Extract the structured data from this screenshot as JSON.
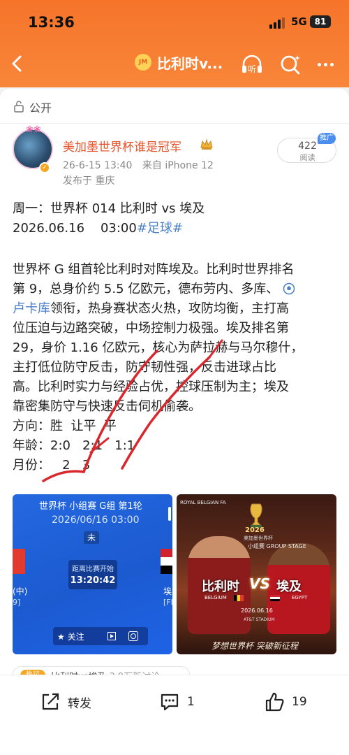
{
  "status_bar": {
    "time": "13:36",
    "network": "5G",
    "battery": "81"
  },
  "nav": {
    "title": "比利时v...",
    "title_logo": "JM",
    "listen_label": "听"
  },
  "post": {
    "visibility": "公开",
    "author": "美加墨世界杯谁是冠军",
    "timestamp": "26-6-15 13:40",
    "source": "来自 iPhone 12",
    "location": "发布于 重庆",
    "read_count": "422",
    "read_label": "阅读",
    "promo_badge": "推广",
    "lines": {
      "l1": "周一：世界杯 014 比利时 vs 埃及",
      "l2_date": "2026.06.16    03:00",
      "l2_tag": "#足球#",
      "p1": "世界杯 G 组首轮比利时对阵埃及。比利时世界排名",
      "p2a": "第 9，总身价约 5.5 亿欧元，德布劳内、多库、",
      "p3_link": "卢卡库",
      "p3b": "领衔，热身赛状态火热，攻防均衡，主打高",
      "p4": "位压迫与边路突破，中场控制力极强。埃及排名第",
      "p5": "29，身价 1.16 亿欧元，核心为萨拉赫与马尔穆什，",
      "p6": "主打低位防守反击，防守韧性强，反击进球占比",
      "p7": "高。比利时实力与经验占优，控球压制为主；埃及",
      "p8": "靠密集防守与快速反击伺机偷袭。",
      "p9": "方向：胜  让平  平",
      "p10": "年龄：2:0   2:1   1:1",
      "p11": "月份：   2   3"
    }
  },
  "image_left": {
    "title": "世界杯 小组赛 G组 第1轮",
    "date": "2026/06/16 03:00",
    "status": "未",
    "countdown_label": "距离比赛开始",
    "countdown": "13:20:42",
    "left_side": "(中)",
    "left_side2": "9]",
    "right_side": "埃",
    "right_side2": "[FI",
    "follow": "★ 关注"
  },
  "image_right": {
    "side_text": "ROYAL BELGIAN FA",
    "year": "2026",
    "sub": "美加墨世界杯",
    "stage": "小组赛 GROUP STAGE",
    "team_left": "比利时",
    "vs": "VS",
    "team_right": "埃及",
    "en_left": "BELGIUM",
    "en_right": "EGYPT",
    "date": "2026.06.16",
    "venue": "AT&T STADIUM",
    "slogan": "梦想世界杯 突破新征程"
  },
  "topic": {
    "tag": "热议",
    "text": "比利时vs埃及",
    "meta": "3.9万新讨论"
  },
  "bottom_bar": {
    "forward_label": "转发",
    "comment_count": "1",
    "like_count": "19"
  },
  "colors": {
    "header_orange": "#f5742a",
    "username": "#e8542c",
    "link": "#4a7fc7",
    "annotation_red": "#d9272e"
  }
}
